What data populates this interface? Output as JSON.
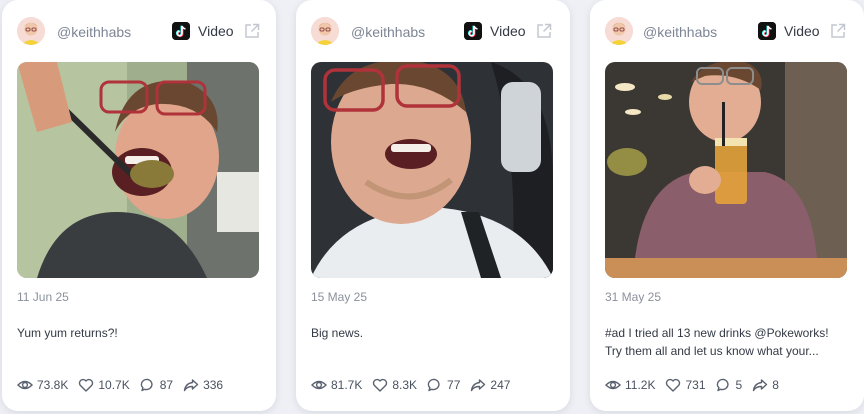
{
  "platform": {
    "name": "TikTok",
    "type_label": "Video"
  },
  "posts": [
    {
      "handle": "@keithhabs",
      "date": "11 Jun 25",
      "caption_lines": [
        "Yum yum returns?!"
      ],
      "stats": {
        "views": "73.8K",
        "likes": "10.7K",
        "comments": "87",
        "shares": "336"
      }
    },
    {
      "handle": "@keithhabs",
      "date": "15 May 25",
      "caption_lines": [
        "Big news."
      ],
      "stats": {
        "views": "81.7K",
        "likes": "8.3K",
        "comments": "77",
        "shares": "247"
      }
    },
    {
      "handle": "@keithhabs",
      "date": "31 May 25",
      "caption_lines": [
        "#ad I tried all 13 new drinks @Pokeworks!",
        "Try them all and let us know what your..."
      ],
      "stats": {
        "views": "11.2K",
        "likes": "731",
        "comments": "5",
        "shares": "8"
      }
    }
  ],
  "colors": {
    "page_bg": "#eef0f5",
    "card_bg": "#ffffff",
    "muted_text": "#7d8595",
    "body_text": "#333a45",
    "icon_gray": "#5b6270"
  },
  "icons": {
    "views": "eye-icon",
    "likes": "heart-icon",
    "comments": "comment-icon",
    "shares": "share-icon",
    "platform": "tiktok-icon",
    "open": "external-link-icon"
  }
}
